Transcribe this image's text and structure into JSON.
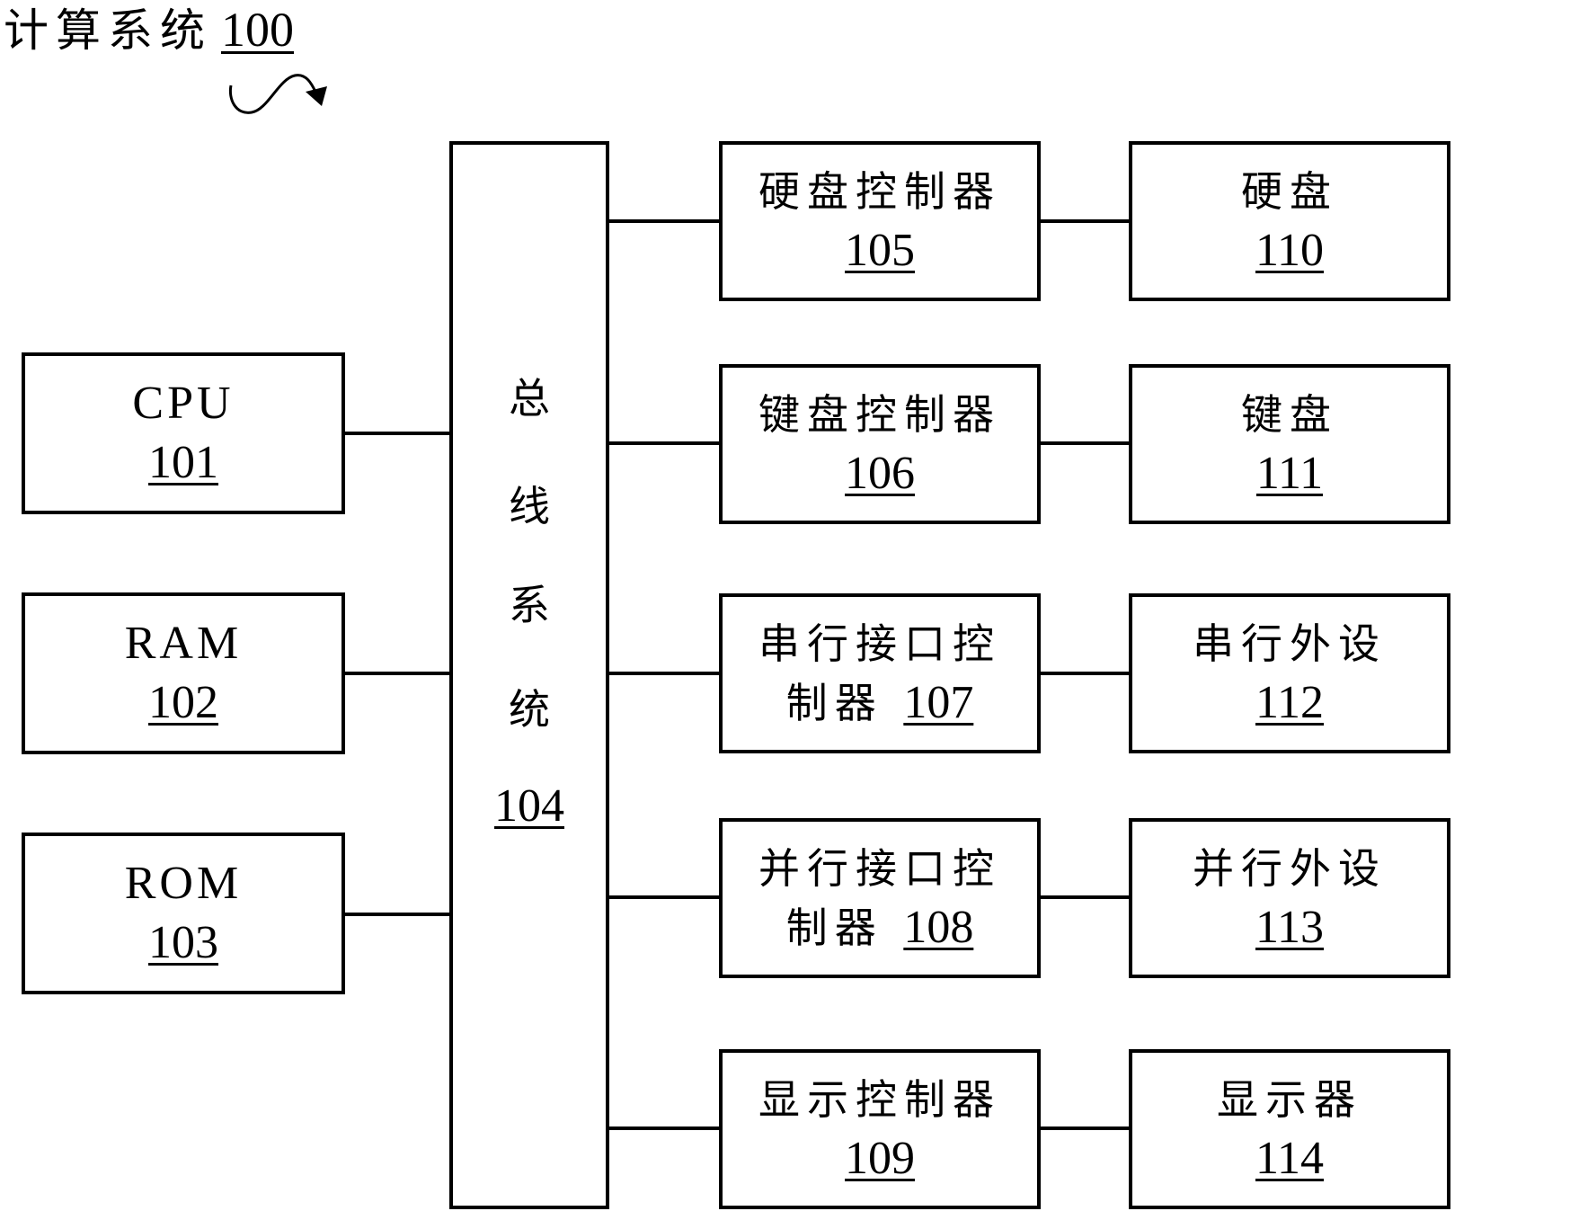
{
  "title": {
    "label": "计算系统",
    "ref": "100"
  },
  "bus": {
    "chars": [
      "总",
      "线",
      "系",
      "统"
    ],
    "ref": "104"
  },
  "left_components": [
    {
      "label": "CPU",
      "ref": "101"
    },
    {
      "label": "RAM",
      "ref": "102"
    },
    {
      "label": "ROM",
      "ref": "103"
    }
  ],
  "controllers": [
    {
      "line1": "硬盘控制器",
      "line2_text": "",
      "ref": "105"
    },
    {
      "line1": "键盘控制器",
      "line2_text": "",
      "ref": "106"
    },
    {
      "line1": "串行接口控",
      "line2_text": "制器 ",
      "ref": "107"
    },
    {
      "line1": "并行接口控",
      "line2_text": "制器 ",
      "ref": "108"
    },
    {
      "line1": "显示控制器",
      "line2_text": "",
      "ref": "109"
    }
  ],
  "devices": [
    {
      "label": "硬盘",
      "ref": "110"
    },
    {
      "label": "键盘",
      "ref": "111"
    },
    {
      "label": "串行外设",
      "ref": "112"
    },
    {
      "label": "并行外设",
      "ref": "113"
    },
    {
      "label": "显示器",
      "ref": "114"
    }
  ]
}
